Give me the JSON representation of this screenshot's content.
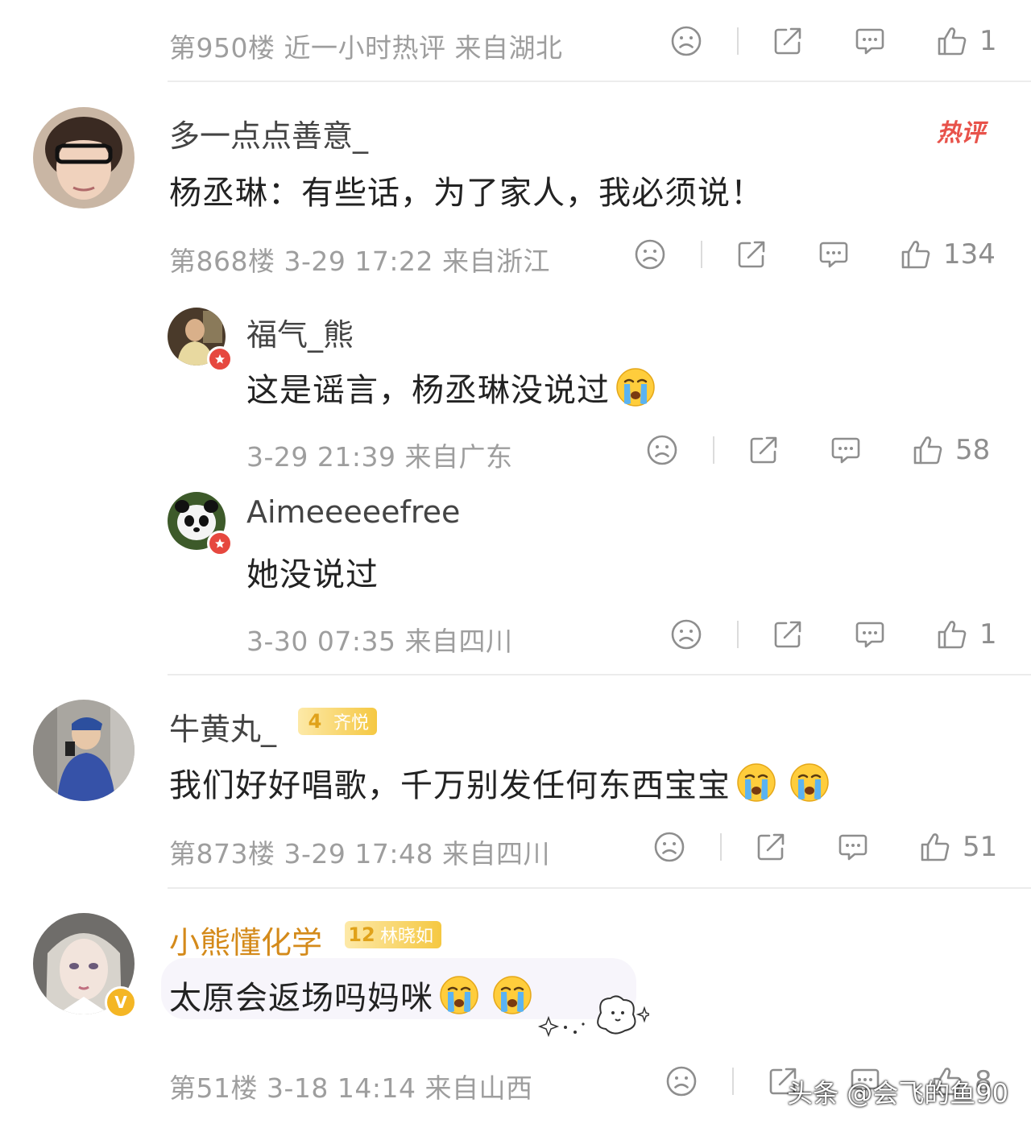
{
  "comments": [
    {
      "meta": "第950楼  近一小时热评  来自湖北",
      "likes": "1"
    },
    {
      "username": "多一点点善意_",
      "hot_label": "热评",
      "text": "杨丞琳：有些话，为了家人，我必须说！",
      "meta": "第868楼  3-29 17:22  来自浙江",
      "likes": "134",
      "replies": [
        {
          "username": "福气_熊",
          "text": "这是谣言，杨丞琳没说过",
          "emoji": [
            "loudly-crying-emoji"
          ],
          "meta": "3-29 21:39  来自广东",
          "likes": "58"
        },
        {
          "username": "Aimeeeeefree",
          "text": "她没说过",
          "meta": "3-30 07:35  来自四川",
          "likes": "1"
        }
      ]
    },
    {
      "username": "牛黄丸_",
      "badge": {
        "level": "4",
        "label": "齐悦"
      },
      "text": "我们好好唱歌，千万别发任何东西宝宝",
      "emoji": [
        "loudly-crying-emoji",
        "loudly-crying-emoji"
      ],
      "meta": "第873楼  3-29 17:48  来自四川",
      "likes": "51"
    },
    {
      "username": "小熊懂化学",
      "badge": {
        "level": "12",
        "label": "林晓如"
      },
      "verified_mark": "V",
      "text": "太原会返场吗妈咪",
      "emoji": [
        "loudly-crying-emoji",
        "loudly-crying-emoji"
      ],
      "meta": "第51楼  3-18 14:14  来自山西",
      "likes": "8"
    }
  ],
  "watermark": "头条 @会飞的鱼90",
  "colors": {
    "meta_gray": "#9e9e9e",
    "hot_red": "#e8524a",
    "gold_name": "#d48a1a",
    "badge_gold": "#f5c842",
    "divider": "#ececec"
  }
}
